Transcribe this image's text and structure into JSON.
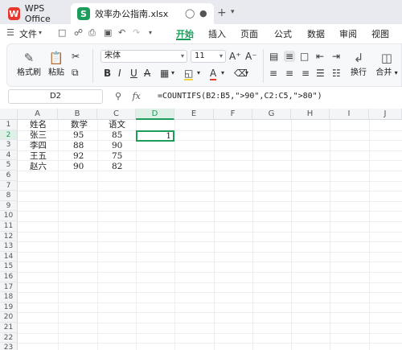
{
  "titlebar": {
    "app_tab": "WPS Office",
    "file_tab": "效率办公指南.xlsx",
    "app_logo": "W",
    "file_logo": "S",
    "icons": [
      "lightbulb-icon",
      "dot-icon",
      "close-icon",
      "plus-icon",
      "chevron-down-icon"
    ]
  },
  "menubar": {
    "file_menu": "文件",
    "tabs": [
      "开始",
      "插入",
      "页面",
      "公式",
      "数据",
      "审阅",
      "视图"
    ],
    "active_tab": "开始",
    "accent": "#1d9c5b"
  },
  "ribbon": {
    "format_painter": "格式刷",
    "paste": "粘贴",
    "font_name": "宋体",
    "font_size": "11",
    "wrap": "换行",
    "merge": "合并"
  },
  "formula_bar": {
    "name_box": "D2",
    "fx": "fx",
    "formula": "=COUNTIFS(B2:B5,\">90\",C2:C5,\">80\")"
  },
  "sheet": {
    "columns": [
      "A",
      "B",
      "C",
      "D",
      "E",
      "F",
      "G",
      "H",
      "I",
      "J"
    ],
    "selected_column": "D",
    "selected_row": "2",
    "rows": [
      "1",
      "2",
      "3",
      "4",
      "5",
      "6",
      "7",
      "8",
      "9",
      "10",
      "11",
      "12",
      "13",
      "14",
      "15",
      "16",
      "17",
      "18",
      "19",
      "20",
      "21",
      "22",
      "23"
    ],
    "data": [
      [
        "姓名",
        "数学",
        "语文"
      ],
      [
        "张三",
        "95",
        "85"
      ],
      [
        "李四",
        "88",
        "90"
      ],
      [
        "王五",
        "92",
        "75"
      ],
      [
        "赵六",
        "90",
        "82"
      ]
    ],
    "d2_value": "1"
  }
}
